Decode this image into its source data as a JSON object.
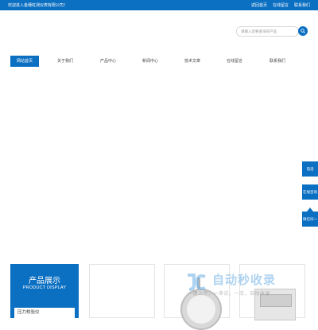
{
  "topbar": {
    "welcome": "欢迎进入金穗虹测仪表有限公司！",
    "links": [
      "返回首页",
      "在线留言",
      "联系我们"
    ]
  },
  "search": {
    "placeholder": "请输入您要查询的产品"
  },
  "nav": {
    "items": [
      "网站首页",
      "关于我们",
      "产品中心",
      "新闻中心",
      "技术文章",
      "在线留言",
      "联系我们"
    ]
  },
  "sidetool": {
    "items": [
      "电话",
      "在线咨询",
      "微信扫一扫"
    ]
  },
  "products": {
    "title_cn": "产品展示",
    "title_en": "PRODUCT DISPLAY",
    "first_category": "压力校验仪"
  },
  "watermark": {
    "big": "自动秒收录",
    "small": "一键上传，一来访，一次，自动收录"
  },
  "colors": {
    "primary": "#0b6fc2"
  }
}
